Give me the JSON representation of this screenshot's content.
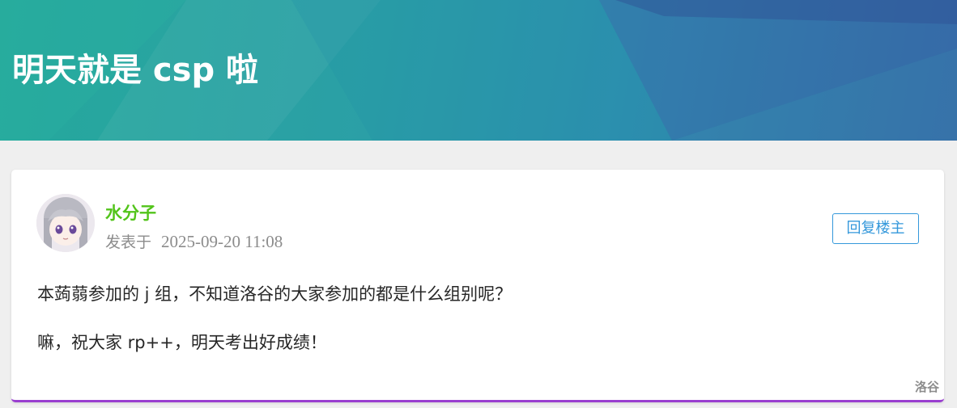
{
  "banner": {
    "title": "明天就是 csp 啦"
  },
  "post": {
    "author": "水分子",
    "posted_label": "发表于",
    "timestamp": "2025-09-20 11:08",
    "reply_button_label": "回复楼主",
    "paragraphs": [
      "本蒟蒻参加的 j 组，不知道洛谷的大家参加的都是什么组别呢？",
      "嘛，祝大家 rp++，明天考出好成绩！"
    ]
  },
  "branding": {
    "watermark": "洛谷"
  },
  "colors": {
    "banner_start": "#25a99c",
    "banner_end": "#3570a8",
    "username": "#52c41a",
    "reply_button": "#3498db",
    "card_bottom_border": "#9a3fd0"
  }
}
